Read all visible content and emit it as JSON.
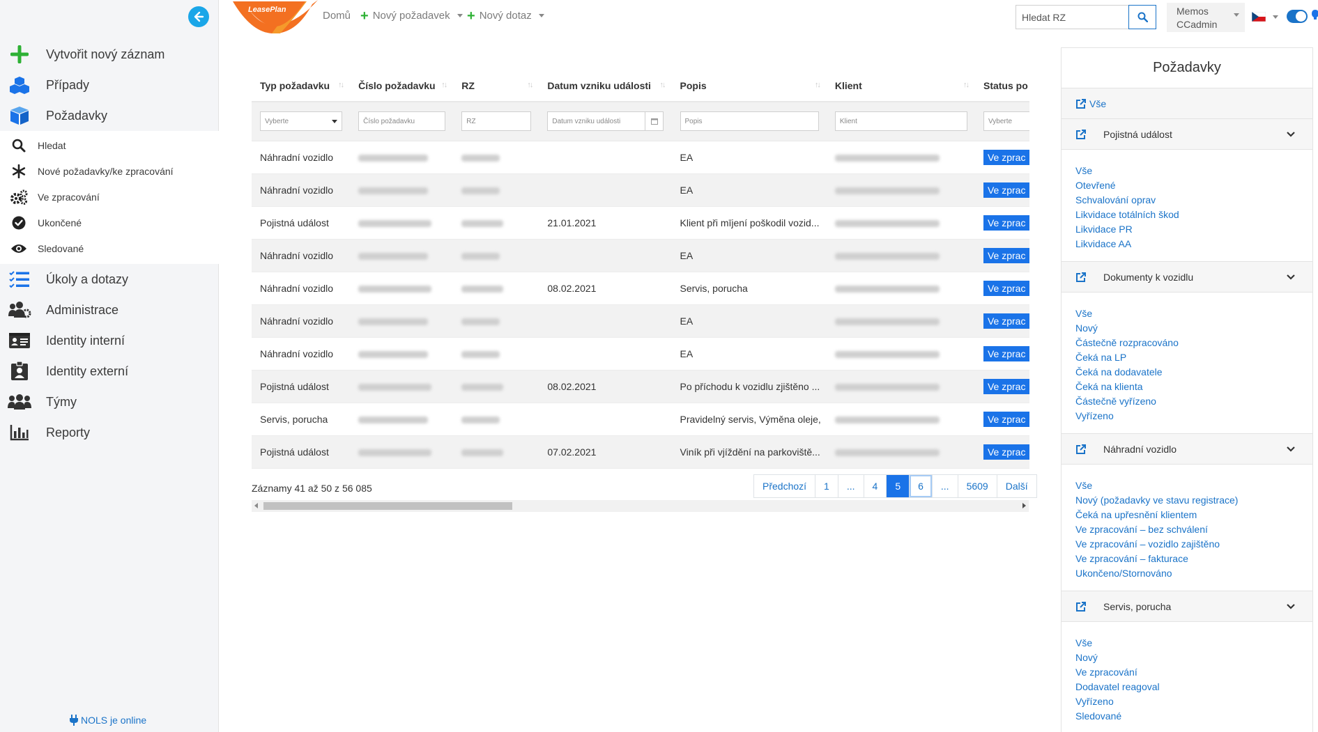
{
  "sidebar": {
    "main_items": [
      {
        "label": "Vytvořit nový záznam",
        "icon": "plus-icon"
      },
      {
        "label": "Případy",
        "icon": "cubes-icon"
      },
      {
        "label": "Požadavky",
        "icon": "cube-icon"
      }
    ],
    "sub_items": [
      {
        "label": "Hledat",
        "icon": "search-icon"
      },
      {
        "label": "Nové požadavky/ke zpracování",
        "icon": "asterisk-icon"
      },
      {
        "label": "Ve zpracování",
        "icon": "cogs-icon"
      },
      {
        "label": "Ukončené",
        "icon": "check-circle-icon"
      },
      {
        "label": "Sledované",
        "icon": "eye-icon"
      }
    ],
    "lower_items": [
      {
        "label": "Úkoly a dotazy",
        "icon": "tasks-icon"
      },
      {
        "label": "Administrace",
        "icon": "users-cog-icon"
      },
      {
        "label": "Identity interní",
        "icon": "id-card-icon"
      },
      {
        "label": "Identity externí",
        "icon": "id-badge-icon"
      },
      {
        "label": "Týmy",
        "icon": "users-icon"
      },
      {
        "label": "Reporty",
        "icon": "bar-chart-icon"
      }
    ],
    "online_status": "NOLS je online"
  },
  "topbar": {
    "logo_text": "LeasePlan",
    "home": "Domů",
    "new_request": "Nový požadavek",
    "new_query": "Nový dotaz",
    "search_placeholder": "Hledat RZ",
    "user_line1": "Memos",
    "user_line2": "CCadmin",
    "language": "cs"
  },
  "table": {
    "columns": [
      "Typ požadavku",
      "Číslo požadavku",
      "RZ",
      "Datum vzniku události",
      "Popis",
      "Klient",
      "Status po"
    ],
    "filters": {
      "type": "Vyberte",
      "number": "Číslo požadavku",
      "rz": "RZ",
      "date": "Datum vzniku události",
      "desc": "Popis",
      "client": "Klient",
      "status": "Vyberte"
    },
    "rows": [
      {
        "type": "Náhradní vozidlo",
        "date": "",
        "desc": "EA",
        "status": "Ve zprac"
      },
      {
        "type": "Náhradní vozidlo",
        "date": "",
        "desc": "EA",
        "status": "Ve zprac"
      },
      {
        "type": "Pojistná událost",
        "date": "21.01.2021",
        "desc": "Klient při mījení poškodil vozid...",
        "status": "Ve zprac"
      },
      {
        "type": "Náhradní vozidlo",
        "date": "",
        "desc": "EA",
        "status": "Ve zprac"
      },
      {
        "type": "Náhradní vozidlo",
        "date": "08.02.2021",
        "desc": "Servis, porucha",
        "status": "Ve zprac"
      },
      {
        "type": "Náhradní vozidlo",
        "date": "",
        "desc": "EA",
        "status": "Ve zprac"
      },
      {
        "type": "Náhradní vozidlo",
        "date": "",
        "desc": "EA",
        "status": "Ve zprac"
      },
      {
        "type": "Pojistná událost",
        "date": "08.02.2021",
        "desc": "Po příchodu k vozidlu zjištěno ...",
        "status": "Ve zprac"
      },
      {
        "type": "Servis, porucha",
        "date": "",
        "desc": "Pravidelný servis, Výměna oleje,",
        "status": "Ve zprac"
      },
      {
        "type": "Pojistná událost",
        "date": "07.02.2021",
        "desc": "Viník při vjíždění na parkoviště...",
        "status": "Ve zprac"
      }
    ],
    "records_info": "Záznamy 41 až 50 z 56 085",
    "pagination": [
      "Předchozí",
      "1",
      "...",
      "4",
      "5",
      "6",
      "...",
      "5609",
      "Další"
    ],
    "current_page": "5"
  },
  "right_panel": {
    "title": "Požadavky",
    "all_label": "Vše",
    "sections": [
      {
        "title": "Pojistná událost",
        "links": [
          "Vše",
          "Otevřené",
          "Schvalování oprav",
          "Likvidace totálních škod",
          "Likvidace PR",
          "Likvidace AA"
        ]
      },
      {
        "title": "Dokumenty k vozidlu",
        "links": [
          "Vše",
          "Nový",
          "Částečně rozpracováno",
          "Čeká na LP",
          "Čeká na dodavatele",
          "Čeká na klienta",
          "Částečně vyřízeno",
          "Vyřízeno"
        ]
      },
      {
        "title": "Náhradní vozidlo",
        "links": [
          "Vše",
          "Nový (požadavky ve stavu registrace)",
          "Čeká na upřesnění klientem",
          "Ve zpracování – bez schválení",
          "Ve zpracování – vozidlo zajištěno",
          "Ve zpracování – fakturace",
          "Ukončeno/Stornováno"
        ]
      },
      {
        "title": "Servis, porucha",
        "links": [
          "Vše",
          "Nový",
          "Ve zpracování",
          "Dodavatel reagoval",
          "Vyřízeno",
          "Sledované"
        ]
      }
    ]
  },
  "colors": {
    "accent": "#1a73e8",
    "link": "#1a73c8",
    "plus_green": "#2eb135",
    "logo_orange": "#f37021"
  }
}
